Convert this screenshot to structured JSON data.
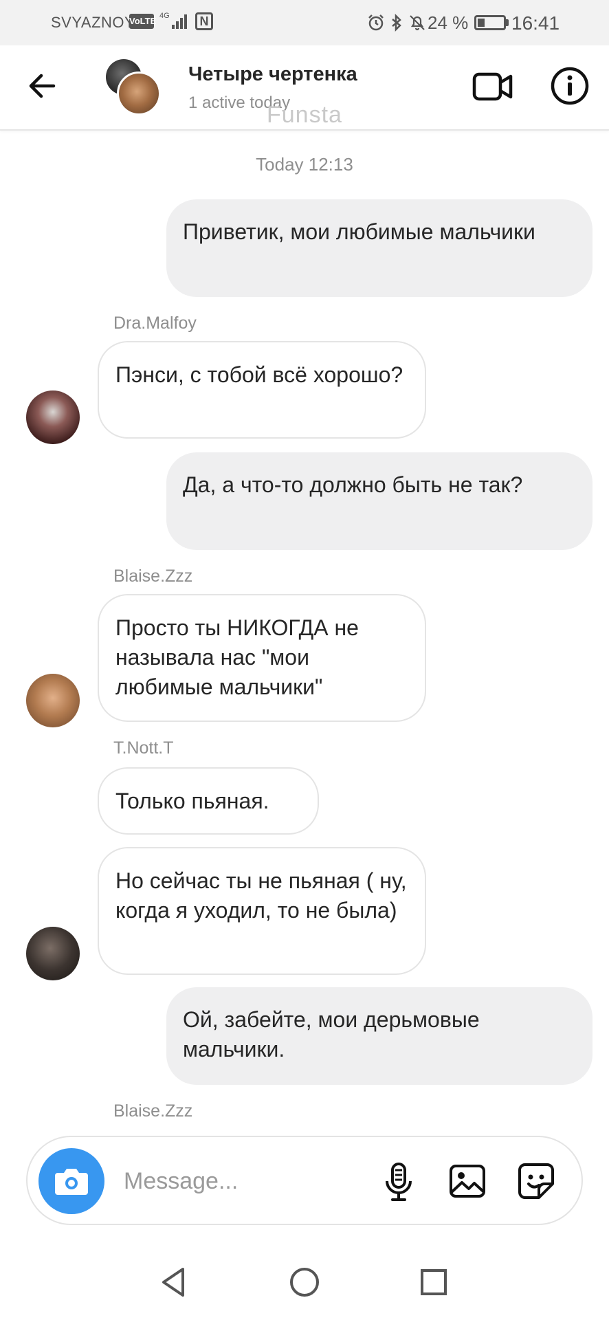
{
  "status_bar": {
    "carrier": "SVYAZNOY",
    "volte": "VoLTE",
    "network": "4G",
    "battery_percent": "24 %",
    "battery_level": 0.24,
    "time": "16:41"
  },
  "header": {
    "title": "Четыре чертенка",
    "subtitle": "1 active today",
    "watermark": "Funsta"
  },
  "chat": {
    "timestamp": "Today 12:13",
    "messages": [
      {
        "direction": "out",
        "text": "Приветик, мои любимые мальчики"
      },
      {
        "direction": "in",
        "sender": "Dra.Malfoy",
        "text": "Пэнси, с тобой всё хорошо?"
      },
      {
        "direction": "out",
        "text": "Да, а что-то должно быть не так?"
      },
      {
        "direction": "in",
        "sender": "Blaise.Zzz",
        "text": "Просто ты НИКОГДА не называла нас \"мои любимые мальчики\""
      },
      {
        "direction": "in",
        "sender": "T.Nott.T",
        "text": "Только пьяная."
      },
      {
        "direction": "in",
        "text": "Но сейчас ты не пьяная ( ну, когда я уходил, то не была)"
      },
      {
        "direction": "out",
        "text": "Ой, забейте, мои дерьмовые мальчики."
      },
      {
        "direction": "in",
        "sender": "Blaise.Zzz"
      }
    ]
  },
  "composer": {
    "placeholder": "Message..."
  },
  "icons": {
    "back": "arrow-left-icon",
    "video": "video-camera-icon",
    "info": "info-icon",
    "camera": "camera-icon",
    "mic": "microphone-icon",
    "gallery": "image-icon",
    "sticker": "sticker-icon"
  },
  "colors": {
    "accent": "#3897f0",
    "outgoing_bubble": "#efeff0",
    "secondary_text": "#8e8e8e"
  }
}
